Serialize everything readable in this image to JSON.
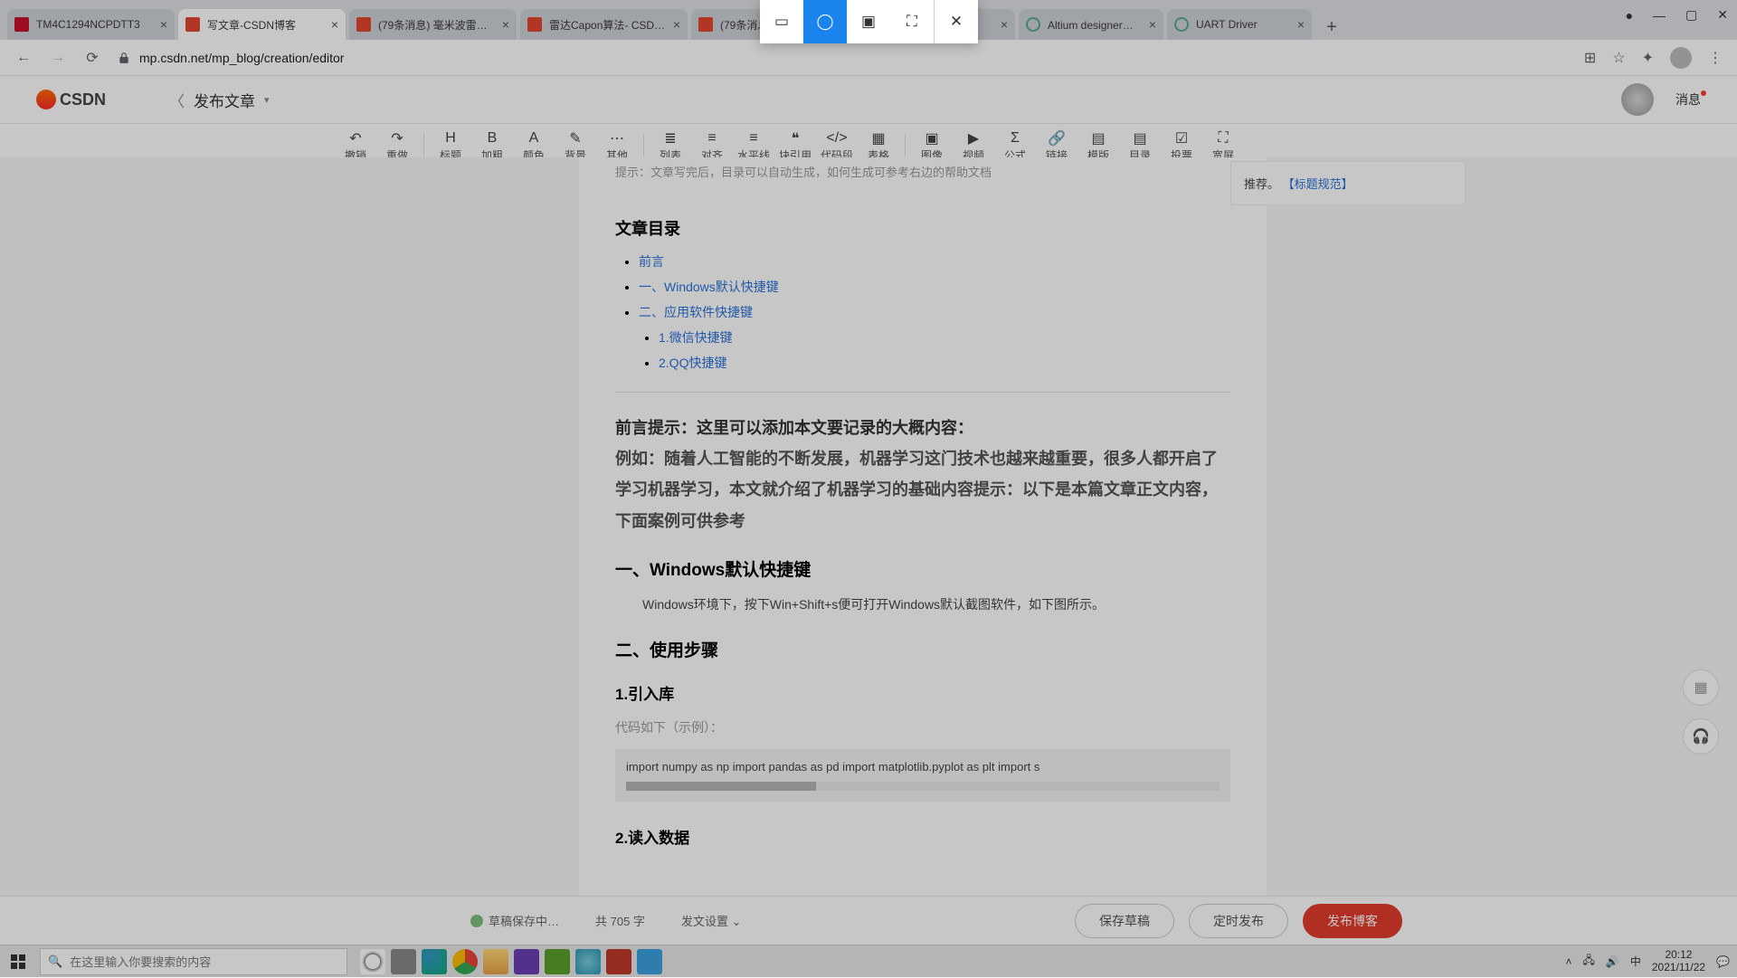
{
  "browser": {
    "tabs": [
      {
        "title": "TM4C1294NCPDTT3",
        "fav": "ti"
      },
      {
        "title": "写文章-CSDN博客",
        "fav": "csdn",
        "active": true
      },
      {
        "title": "(79条消息) 毫米波雷…",
        "fav": "csdn"
      },
      {
        "title": "雷达Capon算法- CSD…",
        "fav": "csdn"
      },
      {
        "title": "(79条消息)",
        "fav": "csdn"
      },
      {
        "title": "",
        "fav": "none"
      },
      {
        "title": "UART Driver",
        "fav": "globe"
      },
      {
        "title": "Altium designer如何…",
        "fav": "globe"
      },
      {
        "title": "UART Driver",
        "fav": "globe"
      }
    ],
    "url": "mp.csdn.net/mp_blog/creation/editor"
  },
  "csdn": {
    "logo": "CSDN",
    "crumb": "发布文章",
    "msg": "消息"
  },
  "toolbar": [
    {
      "ic": "↶",
      "label": "撤销"
    },
    {
      "ic": "↷",
      "label": "重做"
    },
    {
      "sep": true
    },
    {
      "ic": "H",
      "label": "标题"
    },
    {
      "ic": "B",
      "label": "加粗"
    },
    {
      "ic": "A",
      "label": "颜色"
    },
    {
      "ic": "✎",
      "label": "背景"
    },
    {
      "ic": "⋯",
      "label": "其他"
    },
    {
      "sep": true
    },
    {
      "ic": "≣",
      "label": "列表"
    },
    {
      "ic": "≡",
      "label": "对齐"
    },
    {
      "ic": "≡",
      "label": "水平线"
    },
    {
      "ic": "❝",
      "label": "块引用"
    },
    {
      "ic": "</>",
      "label": "代码段"
    },
    {
      "ic": "▦",
      "label": "表格"
    },
    {
      "sep": true
    },
    {
      "ic": "▣",
      "label": "图像"
    },
    {
      "ic": "▶",
      "label": "视频"
    },
    {
      "ic": "Σ",
      "label": "公式"
    },
    {
      "ic": "🔗",
      "label": "链接"
    },
    {
      "ic": "▤",
      "label": "模版"
    },
    {
      "ic": "▤",
      "label": "目录"
    },
    {
      "ic": "☑",
      "label": "投票"
    },
    {
      "ic": "⛶",
      "label": "宽屏"
    }
  ],
  "side": {
    "text": "推荐。",
    "link": "【标题规范】"
  },
  "content": {
    "tip": "提示：文章写完后，目录可以自动生成，如何生成可参考右边的帮助文档",
    "toc_title": "文章目录",
    "toc": [
      {
        "t": "前言"
      },
      {
        "t": "一、Windows默认快捷键"
      },
      {
        "t": "二、应用软件快捷键",
        "children": [
          {
            "t": "1.微信快捷键"
          },
          {
            "t": "2.QQ快捷键"
          }
        ]
      }
    ],
    "h_preface": "前言",
    "preface_rest": "提示：这里可以添加本文要记录的大概内容：",
    "preface_body": "例如：随着人工智能的不断发展，机器学习这门技术也越来越重要，很多人都开启了学习机器学习，本文就介绍了机器学习的基础内容提示：以下是本篇文章正文内容，下面案例可供参考",
    "sec1": "一、Windows默认快捷键",
    "sec1_body": "Windows环境下，按下Win+Shift+s便可打开Windows默认截图软件，如下图所示。",
    "sec2": "二、使用步骤",
    "sub1": "1.引入库",
    "sub1_tip": "代码如下（示例）：",
    "code": "import numpy as np import pandas as pd import matplotlib.pyplot as plt import s",
    "sub2": "2.读入数据"
  },
  "footer": {
    "draft": "草稿保存中…",
    "wordcount": "共 705 字",
    "settings": "发文设置",
    "save": "保存草稿",
    "timed": "定时发布",
    "publish": "发布博客"
  },
  "taskbar": {
    "search_placeholder": "在这里输入你要搜索的内容",
    "time": "20:12",
    "date": "2021/11/22",
    "ime": "中"
  }
}
